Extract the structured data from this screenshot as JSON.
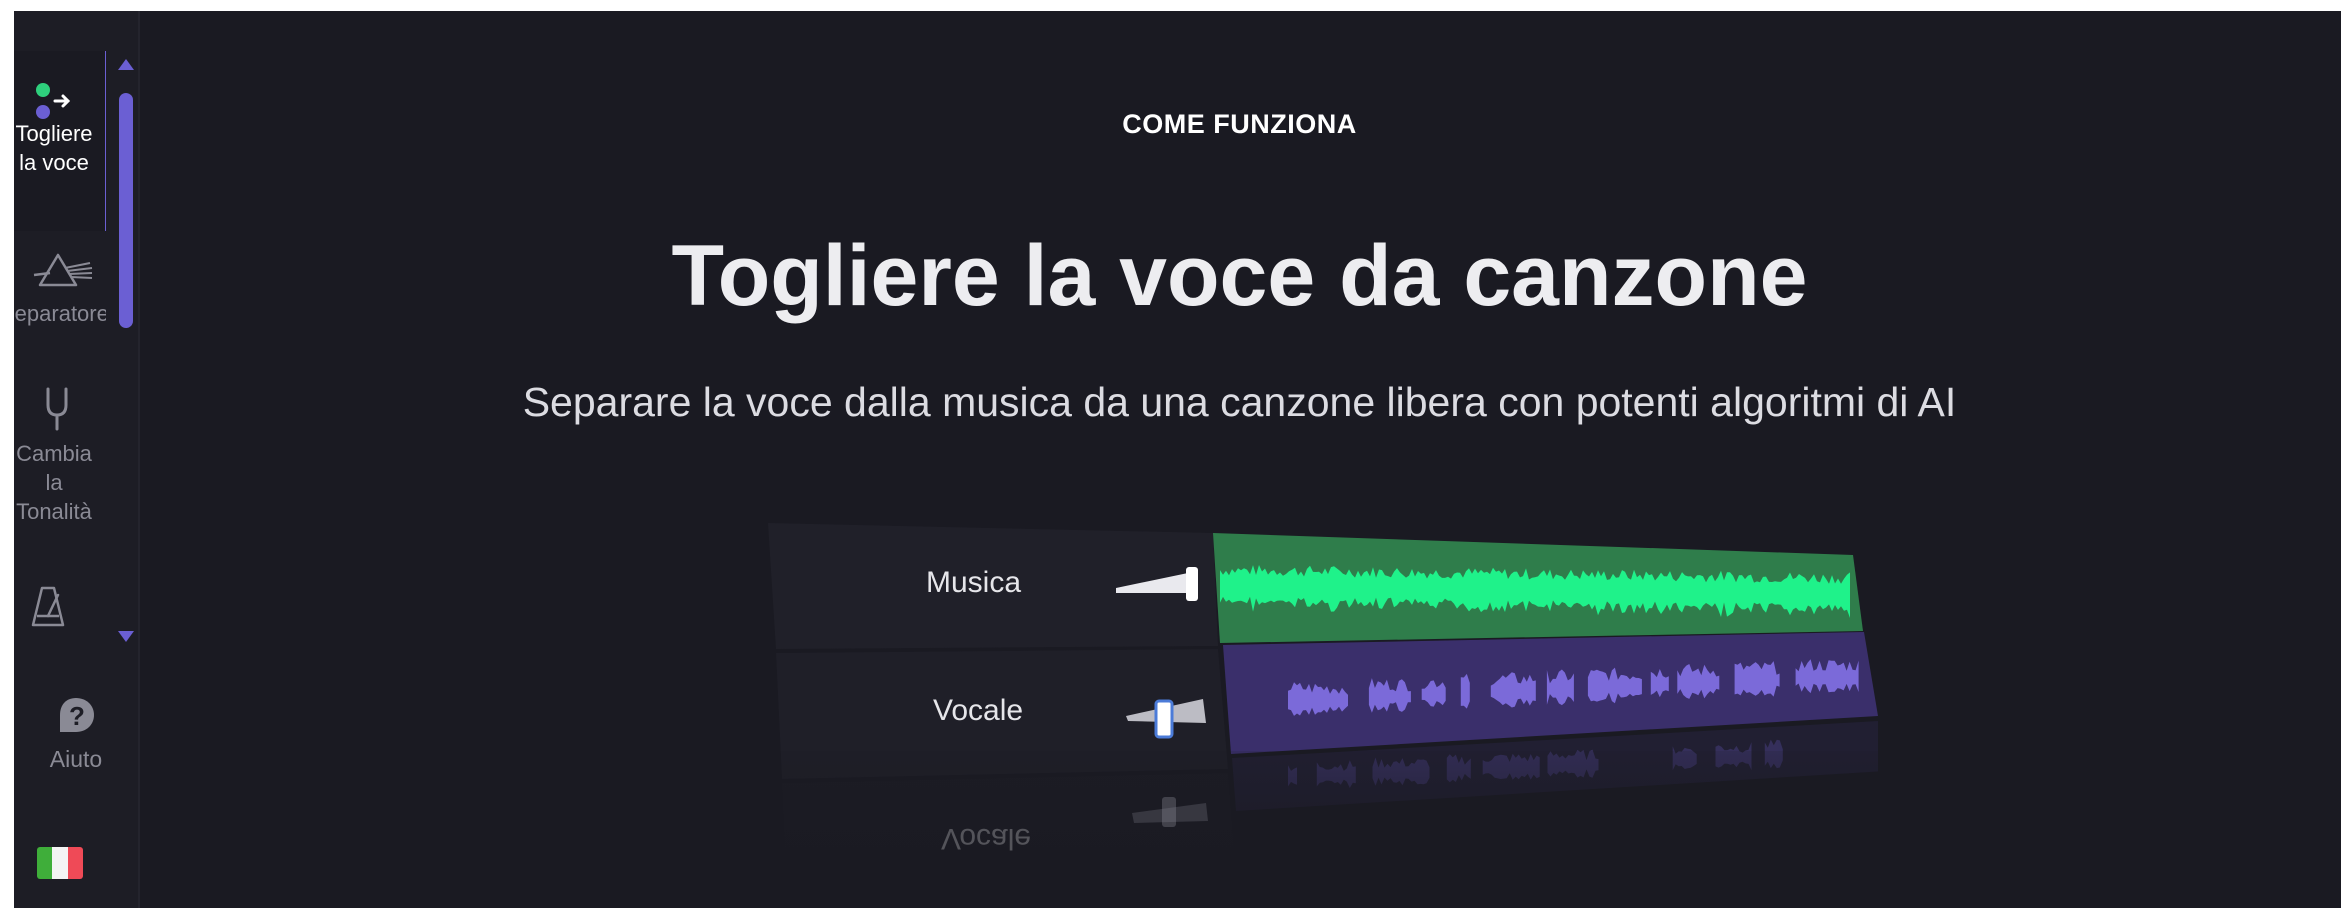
{
  "sidebar": {
    "tools": [
      {
        "label": "Togliere\nla voce",
        "icon": "vocal-remover-icon",
        "active": true
      },
      {
        "label": "Separatore",
        "icon": "prism-splitter-icon",
        "active": false
      },
      {
        "label": "Cambia\nla\nTonalità",
        "icon": "tuning-fork-icon",
        "active": false
      },
      {
        "label": "",
        "icon": "metronome-icon",
        "active": false
      }
    ],
    "help_label": "Aiuto",
    "help_icon": "help-icon",
    "language_flag": "italy-flag-icon"
  },
  "main": {
    "eyebrow": "COME FUNZIONA",
    "title": "Togliere la voce da canzone",
    "subtitle": "Separare la voce dalla musica da una canzone libera con potenti algoritmi di AI",
    "mixer": {
      "tracks": [
        {
          "name": "Musica",
          "color": "#2f7d4b",
          "wave_color": "#1ff28a",
          "volume": 1.0
        },
        {
          "name": "Vocale",
          "color": "#3a2f6b",
          "wave_color": "#7b6ad9",
          "volume": 0.5
        }
      ]
    }
  },
  "colors": {
    "background": "#1a1a22",
    "accent": "#6b5fd3",
    "music_green": "#1ff28a",
    "vocal_purple": "#7b6ad9"
  }
}
